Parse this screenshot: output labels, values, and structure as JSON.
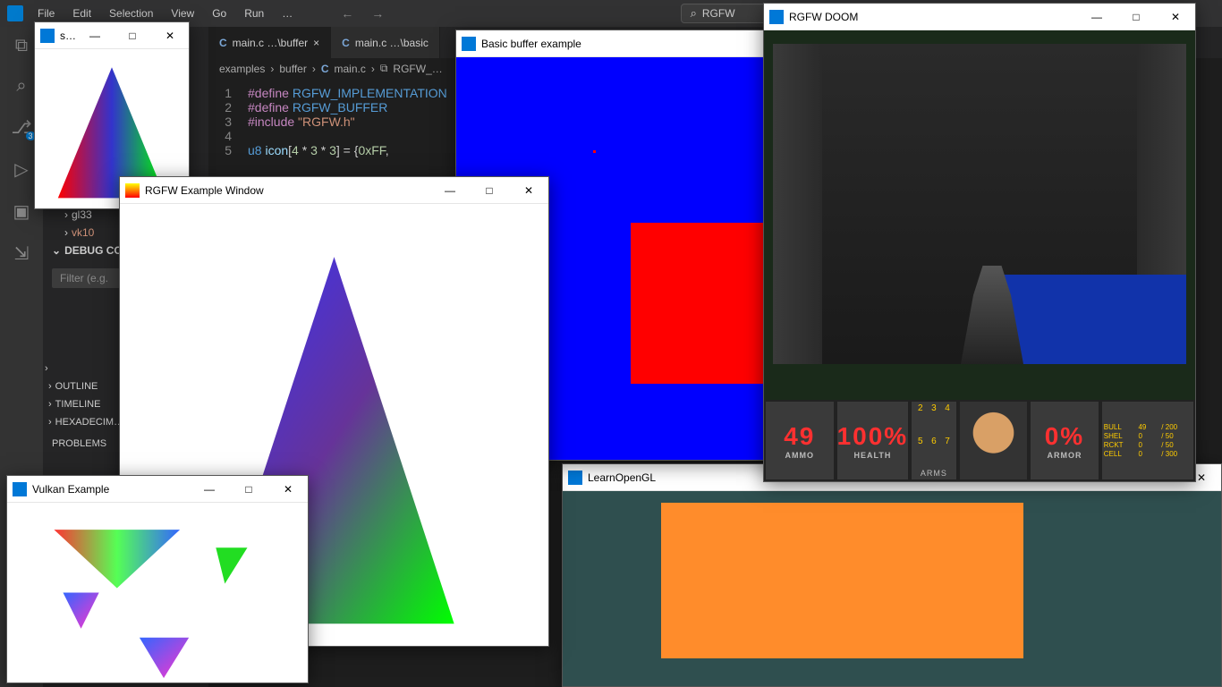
{
  "vscode": {
    "menu": [
      "File",
      "Edit",
      "Selection",
      "View",
      "Go",
      "Run",
      "…"
    ],
    "search_text": "RGFW",
    "tabs": [
      {
        "label": "main.c  …\\buffer",
        "active": true
      },
      {
        "label": "main.c  …\\basic",
        "active": false
      }
    ],
    "breadcrumb": [
      "examples",
      "buffer",
      "main.c",
      "RGFW_…"
    ],
    "code": {
      "lines": [
        {
          "n": 1,
          "tokens": [
            {
              "c": "kw-define",
              "t": "#define "
            },
            {
              "c": "kw-macro",
              "t": "RGFW_IMPLEMENTATION"
            }
          ]
        },
        {
          "n": 2,
          "tokens": [
            {
              "c": "kw-define",
              "t": "#define "
            },
            {
              "c": "kw-macro",
              "t": "RGFW_BUFFER"
            }
          ]
        },
        {
          "n": 3,
          "tokens": [
            {
              "c": "kw-include",
              "t": "#include "
            },
            {
              "c": "kw-str",
              "t": "\"RGFW.h\""
            }
          ]
        },
        {
          "n": 4,
          "tokens": []
        },
        {
          "n": 5,
          "tokens": [
            {
              "c": "kw-type",
              "t": "u8 "
            },
            {
              "c": "kw-var",
              "t": "icon"
            },
            {
              "c": "",
              "t": "["
            },
            {
              "c": "kw-num",
              "t": "4"
            },
            {
              "c": "",
              "t": " * "
            },
            {
              "c": "kw-num",
              "t": "3"
            },
            {
              "c": "",
              "t": " * "
            },
            {
              "c": "kw-num",
              "t": "3"
            },
            {
              "c": "",
              "t": "] = {"
            },
            {
              "c": "kw-num",
              "t": "0xFF"
            },
            {
              "c": "",
              "t": ","
            }
          ]
        }
      ]
    },
    "side": {
      "gl33": "gl33",
      "vk10": "vk10",
      "debug": "DEBUG CON…",
      "filter_placeholder": "Filter (e.g.",
      "outline": "OUTLINE",
      "timeline": "TIMELINE",
      "hexa": "HEXADECIM…",
      "problems": "PROBLEMS"
    }
  },
  "windows": {
    "small_tri": {
      "title": "s…"
    },
    "example": {
      "title": "RGFW Example Window"
    },
    "vulkan": {
      "title": "Vulkan Example"
    },
    "buffer": {
      "title": "Basic buffer example"
    },
    "doom": {
      "title": "RGFW DOOM"
    },
    "learngl": {
      "title": "LearnOpenGL"
    }
  },
  "win_buttons": {
    "min": "—",
    "max": "□",
    "close": "✕"
  },
  "doom_hud": {
    "ammo_val": "49",
    "ammo_lbl": "AMMO",
    "health_val": "100%",
    "health_lbl": "HEALTH",
    "arms_lbl": "ARMS",
    "arms": [
      "2",
      "3",
      "4",
      "5",
      "6",
      "7"
    ],
    "armor_val": "0%",
    "armor_lbl": "ARMOR",
    "ammo_rows": [
      [
        "BULL",
        "49",
        "/ 200"
      ],
      [
        "SHEL",
        "0",
        "/ 50"
      ],
      [
        "RCKT",
        "0",
        "/ 50"
      ],
      [
        "CELL",
        "0",
        "/ 300"
      ]
    ]
  }
}
